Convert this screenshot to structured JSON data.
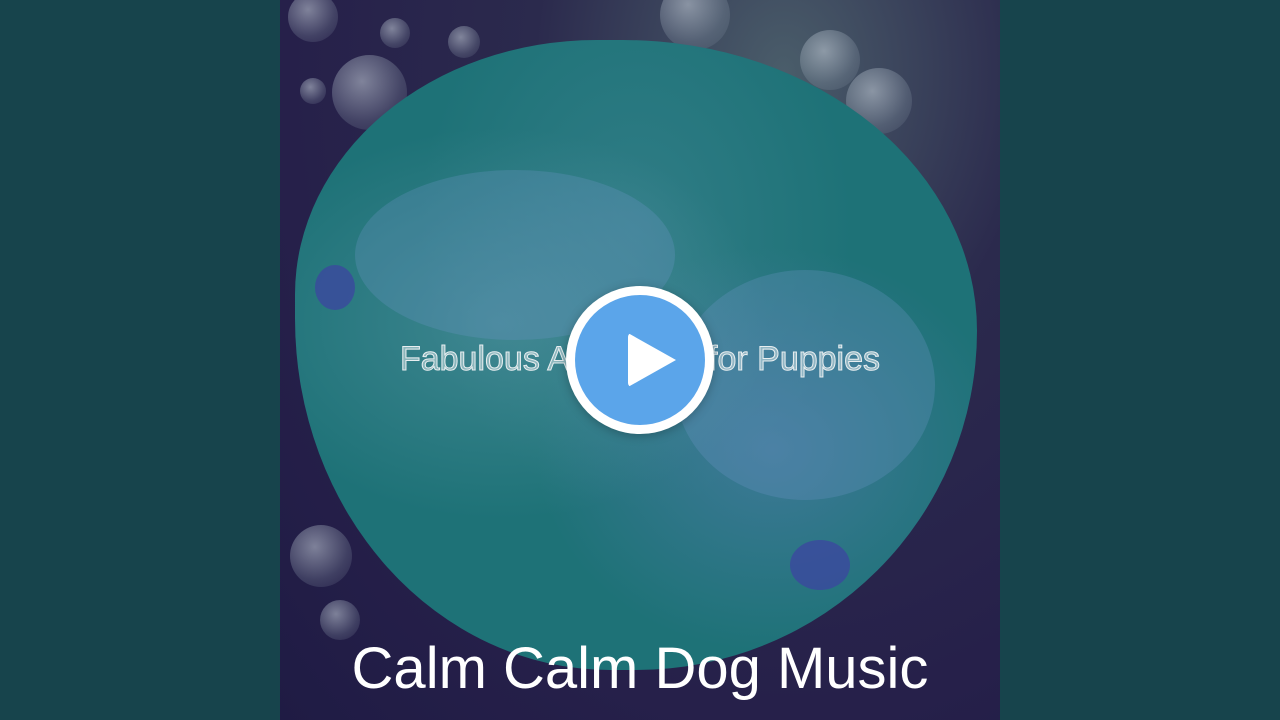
{
  "video": {
    "track_title": "Fabulous Ambience for Puppies",
    "artist_name": "Calm Calm Dog Music"
  },
  "colors": {
    "side_background": "#17444c",
    "artwork_blob": "#1e7277",
    "play_button": "#5ba5ea",
    "artist_text": "#ffffff"
  },
  "icons": {
    "play": "play-icon"
  }
}
